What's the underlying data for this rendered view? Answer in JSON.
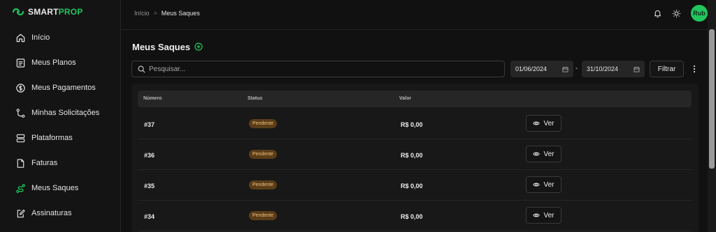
{
  "brand": {
    "name_part1": "SMART",
    "name_part2": "PROP"
  },
  "sidebar": {
    "items": [
      {
        "label": "Início",
        "icon": "home-icon"
      },
      {
        "label": "Meus Planos",
        "icon": "list-icon"
      },
      {
        "label": "Meus Pagamentos",
        "icon": "dollar-icon"
      },
      {
        "label": "Minhas Solicitações",
        "icon": "git-icon"
      },
      {
        "label": "Plataformas",
        "icon": "server-icon"
      },
      {
        "label": "Faturas",
        "icon": "file-icon"
      },
      {
        "label": "Meus Saques",
        "icon": "route-icon",
        "active": true
      },
      {
        "label": "Assinaturas",
        "icon": "edit-icon"
      }
    ]
  },
  "breadcrumb": {
    "home": "Início",
    "separator": ">",
    "current": "Meus Saques"
  },
  "header": {
    "avatar_text": "Rub"
  },
  "page": {
    "title": "Meus Saques"
  },
  "filters": {
    "search_placeholder": "Pesquisar...",
    "date_from": "01/06/2024",
    "date_to": "31/10/2024",
    "dash": "-",
    "filter_label": "Filtrar"
  },
  "table": {
    "columns": [
      "Número",
      "Status",
      "Valor"
    ],
    "rows": [
      {
        "numero": "#37",
        "status": "Pendente",
        "valor": "R$ 0,00",
        "action": "Ver"
      },
      {
        "numero": "#36",
        "status": "Pendente",
        "valor": "R$ 0,00",
        "action": "Ver"
      },
      {
        "numero": "#35",
        "status": "Pendente",
        "valor": "R$ 0,00",
        "action": "Ver"
      },
      {
        "numero": "#34",
        "status": "Pendente",
        "valor": "R$ 0,00",
        "action": "Ver"
      }
    ]
  },
  "colors": {
    "accent": "#22c55e",
    "pending_bg": "#5a3d18",
    "pending_text": "#f0c080",
    "background": "#111111"
  }
}
